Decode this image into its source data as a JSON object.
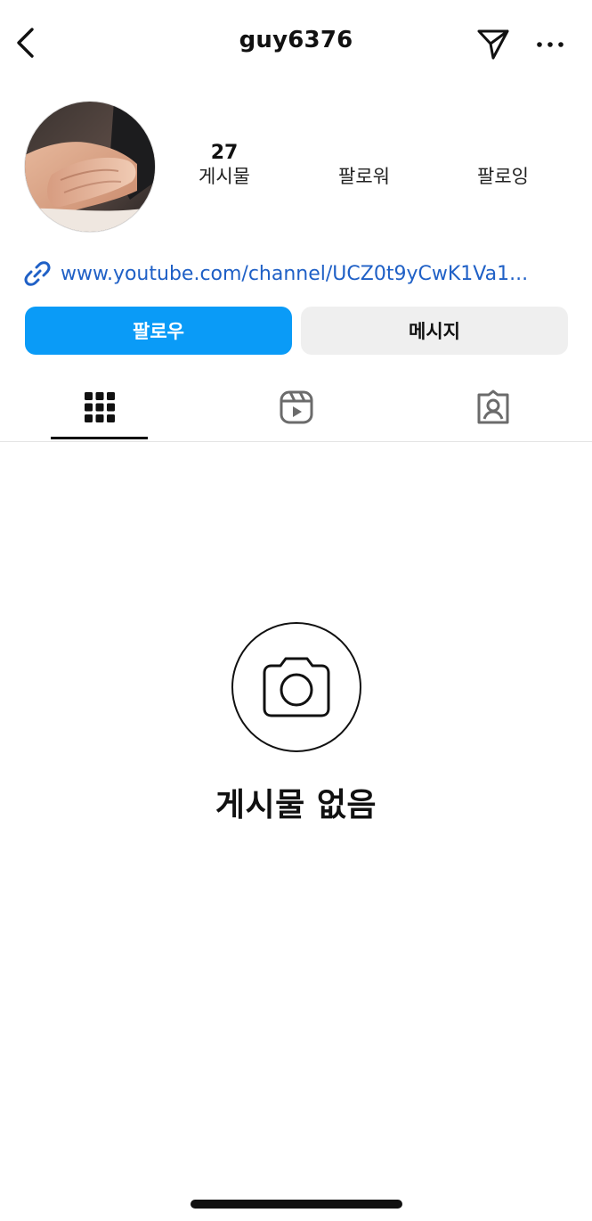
{
  "header": {
    "username": "guy6376"
  },
  "profile": {
    "stats": [
      {
        "count": "27",
        "label": "게시물"
      },
      {
        "count": "",
        "label": "팔로워"
      },
      {
        "count": "",
        "label": "팔로잉"
      }
    ],
    "link_text": "www.youtube.com/channel/UCZ0t9yCwK1Va1..."
  },
  "actions": {
    "follow_label": "팔로우",
    "message_label": "메시지"
  },
  "tabs": [
    {
      "icon": "grid-icon",
      "active": true
    },
    {
      "icon": "reels-icon",
      "active": false
    },
    {
      "icon": "tagged-icon",
      "active": false
    }
  ],
  "empty_state": {
    "icon": "camera-icon",
    "title": "게시물 없음"
  },
  "colors": {
    "accent": "#0a9bf7",
    "link": "#1f60c6",
    "secondary_button": "#efefef"
  }
}
